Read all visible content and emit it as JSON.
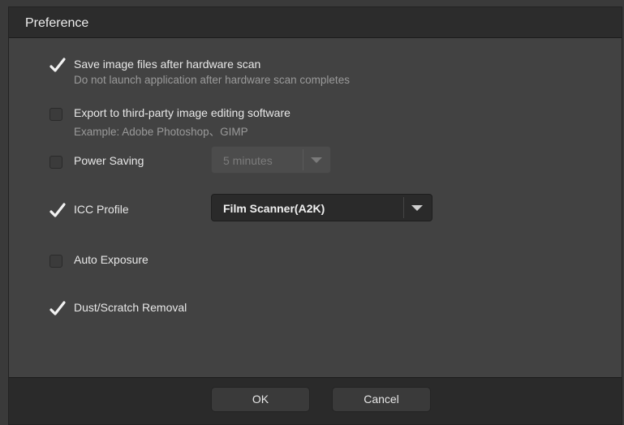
{
  "dialog": {
    "title": "Preference"
  },
  "options": {
    "save_files": {
      "label": "Save image files after hardware scan",
      "sub": "Do not launch application after hardware scan completes",
      "checked": true
    },
    "export": {
      "label": "Export to third-party image editing software",
      "sub": "Example: Adobe Photoshop、GIMP",
      "checked": false
    },
    "power_saving": {
      "label": "Power Saving",
      "checked": false,
      "select_value": "5 minutes",
      "select_enabled": false
    },
    "icc_profile": {
      "label": "ICC Profile",
      "checked": true,
      "select_value": "Film Scanner(A2K)",
      "select_enabled": true
    },
    "auto_exposure": {
      "label": "Auto Exposure",
      "checked": false
    },
    "dust_removal": {
      "label": "Dust/Scratch Removal",
      "checked": true
    }
  },
  "footer": {
    "ok_label": "OK",
    "cancel_label": "Cancel"
  }
}
